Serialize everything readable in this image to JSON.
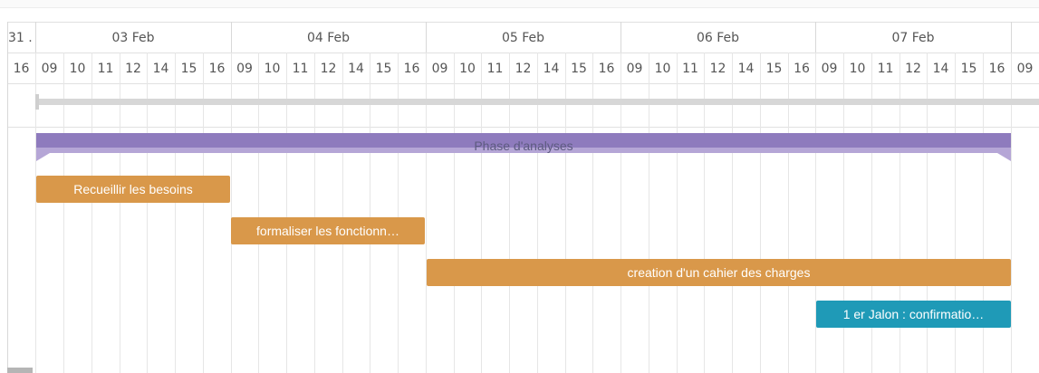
{
  "timeline": {
    "days": [
      "31 .",
      "03 Feb",
      "04 Feb",
      "05 Feb",
      "06 Feb",
      "07 Feb"
    ],
    "hours": [
      "16",
      "09",
      "10",
      "11",
      "12",
      "14",
      "15",
      "16",
      "09",
      "10",
      "11",
      "12",
      "14",
      "15",
      "16",
      "09",
      "10",
      "11",
      "12",
      "14",
      "15",
      "16",
      "09",
      "10",
      "11",
      "12",
      "14",
      "15",
      "16",
      "09",
      "10",
      "11",
      "12",
      "14",
      "15",
      "16",
      "09"
    ]
  },
  "phase": {
    "label": "Phase d'analyses",
    "color": "#8e7bbd",
    "color_light": "#b5a6d6"
  },
  "tasks": [
    {
      "label": "Recueillir les besoins",
      "color": "#d9984a"
    },
    {
      "label": "formaliser les fonctionn…",
      "color": "#d9984a"
    },
    {
      "label": "creation d'un cahier des charges",
      "color": "#d9984a"
    }
  ],
  "milestone": {
    "label": "1 er Jalon : confirmatio…",
    "color": "#1f9ab7"
  }
}
